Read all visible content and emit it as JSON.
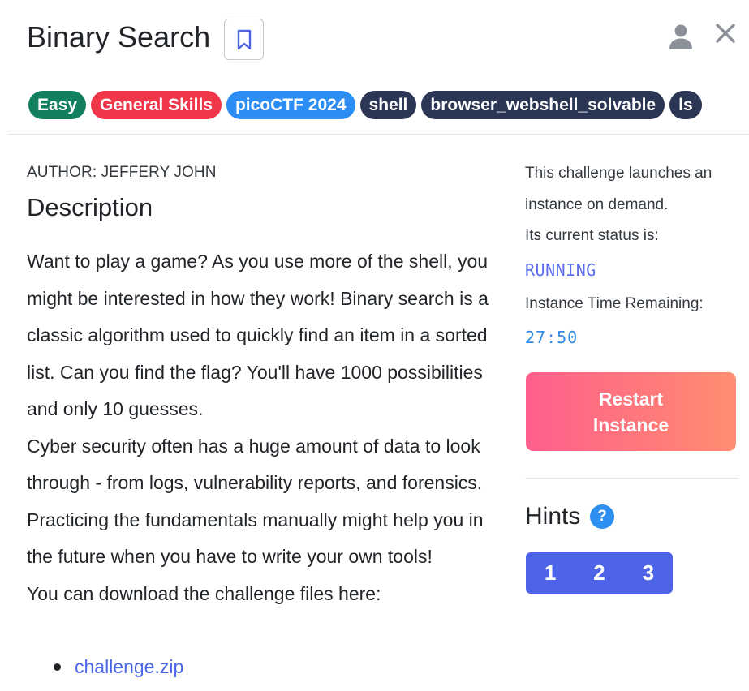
{
  "header": {
    "title": "Binary Search"
  },
  "tags": [
    {
      "label": "Easy",
      "color": "#127f5f"
    },
    {
      "label": "General Skills",
      "color": "#f0374a"
    },
    {
      "label": "picoCTF 2024",
      "color": "#2c8ef5"
    },
    {
      "label": "shell",
      "color": "#2b3654"
    },
    {
      "label": "browser_webshell_solvable",
      "color": "#2b3654"
    },
    {
      "label": "ls",
      "color": "#2b3654"
    }
  ],
  "main": {
    "author": "AUTHOR: JEFFERY JOHN",
    "description_heading": "Description",
    "description_p1": "Want to play a game? As you use more of the shell, you might be interested in how they work! Binary search is a classic algorithm used to quickly find an item in a sorted list. Can you find the flag? You'll have 1000 possibilities and only 10 guesses.",
    "description_p2": "Cyber security often has a huge amount of data to look through - from logs, vulnerability reports, and forensics. Practicing the fundamentals manually might help you in the future when you have to write your own tools!",
    "download_text": "You can download the challenge files here:",
    "files": [
      "challenge.zip"
    ]
  },
  "sidebar": {
    "launch_text": "This challenge launches an instance on demand.",
    "status_label": "Its current status is:",
    "status_value": "RUNNING",
    "time_label": "Instance Time Remaining:",
    "time_value": "27:50",
    "restart_label": "Restart Instance",
    "hints_title": "Hints",
    "help_glyph": "?",
    "hints": [
      "1",
      "2",
      "3"
    ]
  }
}
